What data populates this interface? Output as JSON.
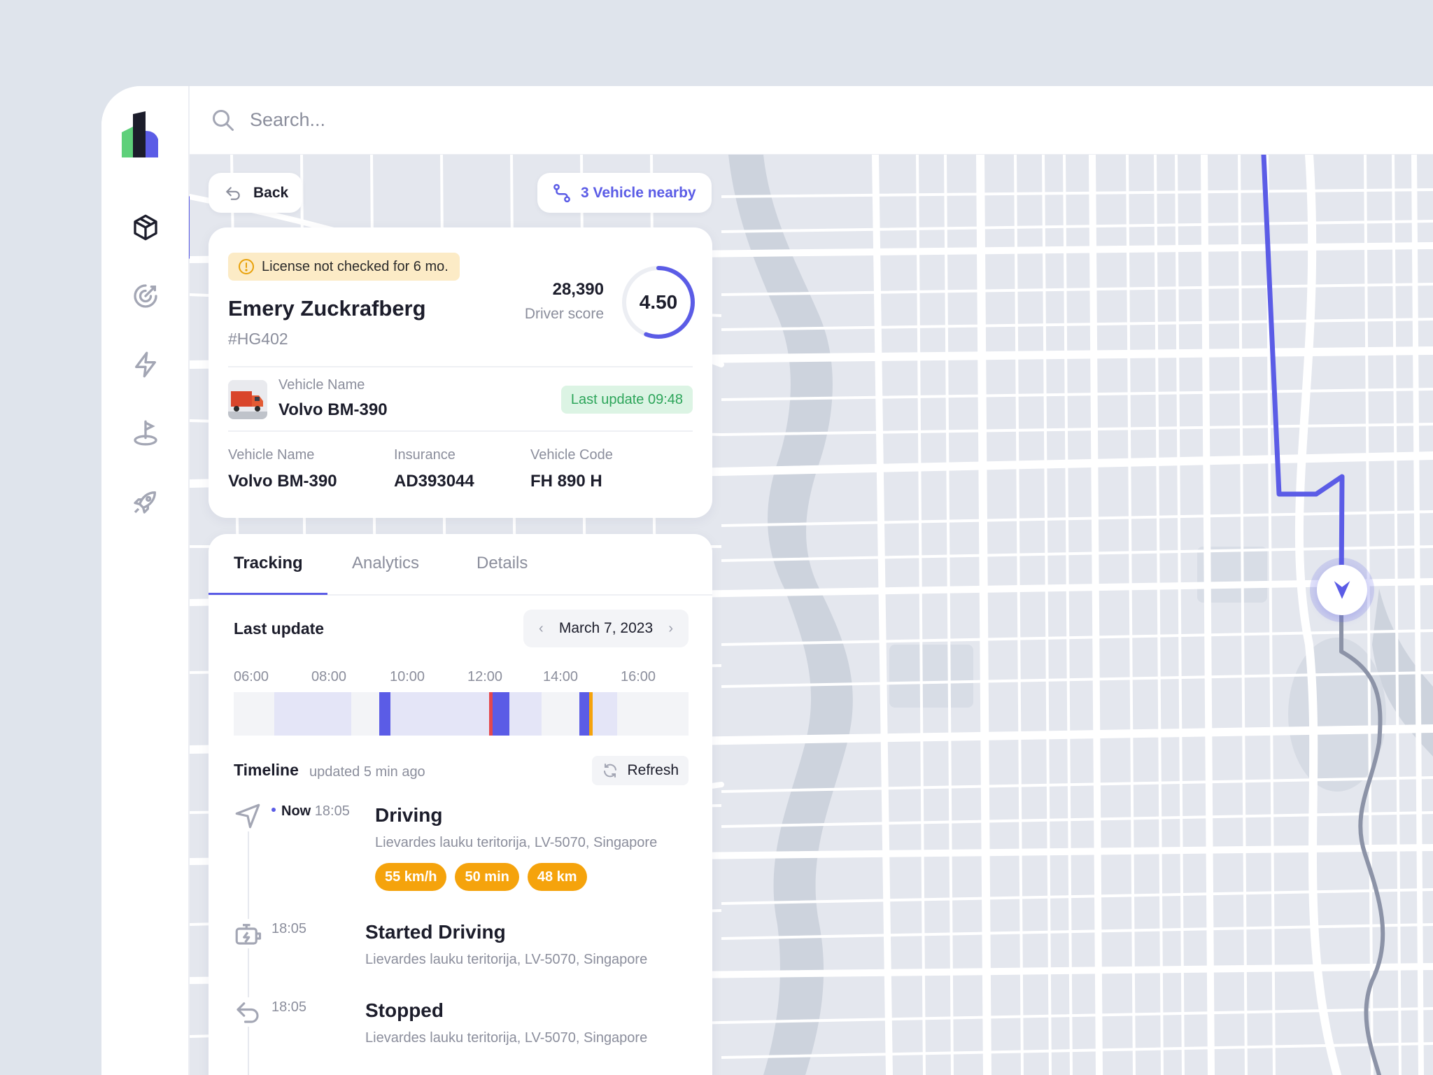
{
  "search": {
    "placeholder": "Search..."
  },
  "sidebar": {
    "items": [
      {
        "icon": "box-icon",
        "active": true
      },
      {
        "icon": "target-icon",
        "active": false
      },
      {
        "icon": "lightning-icon",
        "active": false
      },
      {
        "icon": "location-pin-icon",
        "active": false
      },
      {
        "icon": "rocket-icon",
        "active": false
      }
    ]
  },
  "map_controls": {
    "back_label": "Back",
    "nearby_label": "3 Vehicle nearby"
  },
  "driver": {
    "warning": "License not checked for 6 mo.",
    "name": "Emery Zuckrafberg",
    "id": "#HG402",
    "score_count": "28,390",
    "score_label": "Driver score",
    "rating": "4.50",
    "vehicle_label": "Vehicle Name",
    "vehicle_name": "Volvo BM-390",
    "last_update": "Last update 09:48",
    "details": [
      {
        "label": "Vehicle Name",
        "value": "Volvo BM-390"
      },
      {
        "label": "Insurance",
        "value": "AD393044"
      },
      {
        "label": "Vehicle Code",
        "value": "FH 890 H"
      }
    ]
  },
  "tabs": [
    "Tracking",
    "Analytics",
    "Details"
  ],
  "tracking": {
    "last_update_title": "Last update",
    "date": "March 7, 2023",
    "hours": [
      "06:00",
      "08:00",
      "10:00",
      "12:00",
      "14:00",
      "16:00"
    ],
    "timeline_title": "Timeline",
    "timeline_sub": "updated 5 min ago",
    "refresh_label": "Refresh"
  },
  "timeline": [
    {
      "now": "Now",
      "time": "18:05",
      "title": "Driving",
      "address": "Lievardes lauku teritorija, LV-5070, Singapore",
      "chips": [
        "55 km/h",
        "50 min",
        "48 km"
      ]
    },
    {
      "time": "18:05",
      "title": "Started Driving",
      "address": "Lievardes lauku teritorija, LV-5070, Singapore"
    },
    {
      "time": "18:05",
      "title": "Stopped",
      "address": "Lievardes lauku teritorija, LV-5070, Singapore"
    }
  ],
  "colors": {
    "accent": "#5b5ce6",
    "warning_bg": "#fcebc6",
    "success_bg": "#dcf4e4",
    "success_text": "#2da55a",
    "chip": "#f5a30c",
    "alert_red": "#e5484d"
  }
}
